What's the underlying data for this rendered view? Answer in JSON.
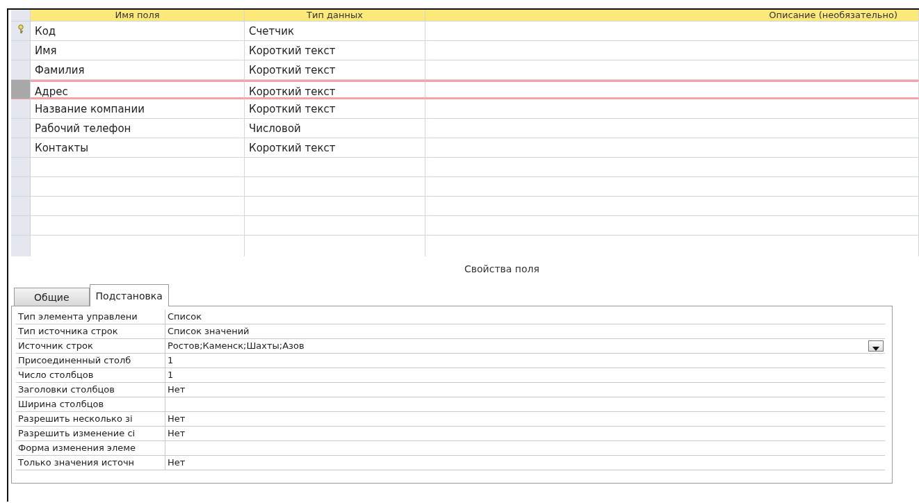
{
  "table": {
    "columns": [
      "Имя поля",
      "Тип данных",
      "Описание (необязательно)"
    ],
    "rows": [
      {
        "name": "Код",
        "type": "Счетчик",
        "primary_key": true,
        "selected": false
      },
      {
        "name": "Имя",
        "type": "Короткий текст",
        "primary_key": false,
        "selected": false
      },
      {
        "name": "Фамилия",
        "type": "Короткий текст",
        "primary_key": false,
        "selected": false
      },
      {
        "name": "Адрес",
        "type": "Короткий текст",
        "primary_key": false,
        "selected": true
      },
      {
        "name": "Название компании",
        "type": "Короткий текст",
        "primary_key": false,
        "selected": false
      },
      {
        "name": "Рабочий телефон",
        "type": "Числовой",
        "primary_key": false,
        "selected": false
      },
      {
        "name": "Контакты",
        "type": "Короткий текст",
        "primary_key": false,
        "selected": false
      }
    ]
  },
  "field_properties": {
    "title": "Свойства поля",
    "tabs": [
      {
        "label": "Общие",
        "selected": false
      },
      {
        "label": "Подстановка",
        "selected": true
      }
    ],
    "properties": [
      {
        "label": "Тип элемента управлени",
        "value": "Список",
        "dropdown": false
      },
      {
        "label": "Тип источника строк",
        "value": "Список значений",
        "dropdown": false
      },
      {
        "label": "Источник строк",
        "value": "Ростов;Каменск;Шахты;Азов",
        "dropdown": true
      },
      {
        "label": "Присоединенный столб",
        "value": "1",
        "dropdown": false
      },
      {
        "label": "Число столбцов",
        "value": "1",
        "dropdown": false
      },
      {
        "label": "Заголовки столбцов",
        "value": "Нет",
        "dropdown": false
      },
      {
        "label": "Ширина столбцов",
        "dropdown": false
      },
      {
        "label": "Разрешить несколько зі",
        "value": "Нет",
        "dropdown": false
      },
      {
        "label": "Разрешить изменение сі",
        "value": "Нет",
        "dropdown": false
      },
      {
        "label": "Форма изменения элеме",
        "dropdown": false
      },
      {
        "label": "Только значения источн",
        "value": "Нет",
        "dropdown": false
      }
    ]
  }
}
